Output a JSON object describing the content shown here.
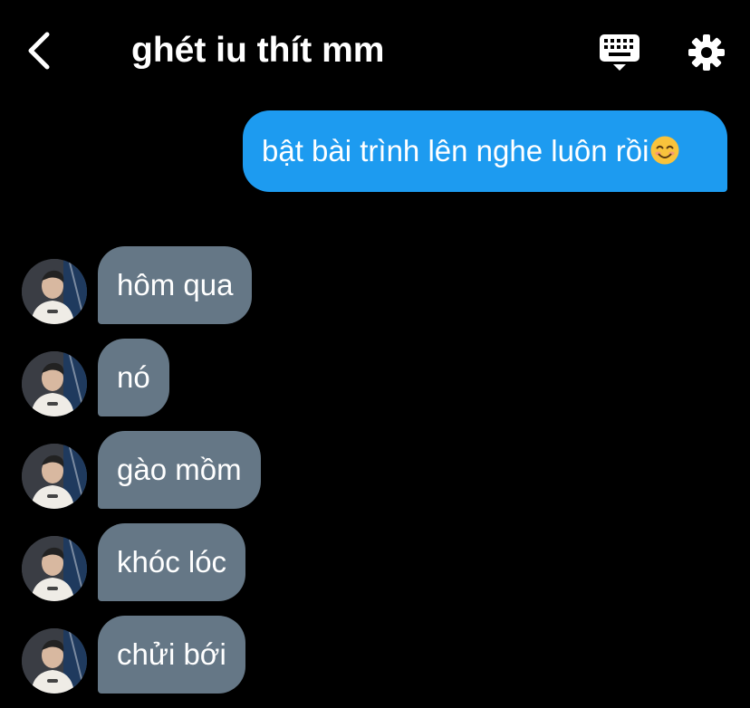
{
  "header": {
    "title": "ghét iu thít mm",
    "back_icon": "chevron-left-icon",
    "keyboard_icon": "keyboard-icon",
    "settings_icon": "gear-icon"
  },
  "messages": {
    "outgoing": {
      "text": "bật bài trình lên nghe luôn rồi",
      "emoji": "smiling-face-emoji"
    },
    "incoming": [
      {
        "text": "hôm qua"
      },
      {
        "text": "nó"
      },
      {
        "text": "gào mồm"
      },
      {
        "text": "khóc lóc"
      },
      {
        "text": "chửi bới"
      }
    ]
  },
  "colors": {
    "background": "#000000",
    "outgoing_bubble": "#1d9bf0",
    "incoming_bubble": "#657786",
    "text": "#ffffff"
  }
}
